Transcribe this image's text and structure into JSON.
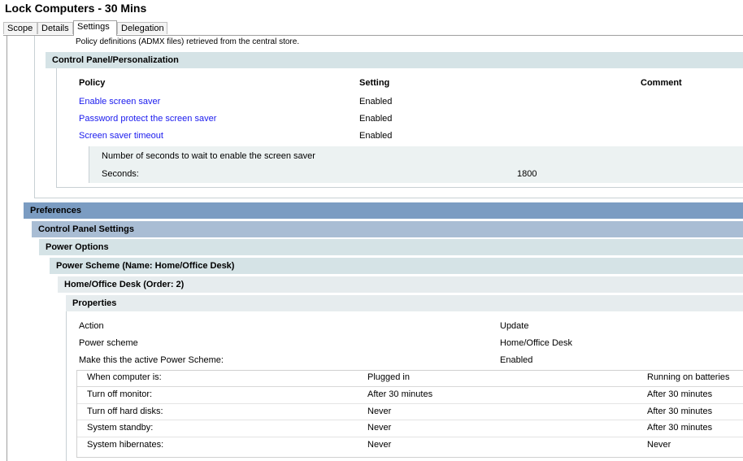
{
  "window": {
    "title": "Lock Computers - 30 Mins"
  },
  "tabs": [
    "Scope",
    "Details",
    "Settings",
    "Delegation"
  ],
  "policies": {
    "note": "Policy definitions (ADMX files) retrieved from the central store.",
    "section_title": "Control Panel/Personalization",
    "columns": {
      "policy": "Policy",
      "setting": "Setting",
      "comment": "Comment"
    },
    "rows": [
      {
        "policy": "Enable screen saver",
        "setting": "Enabled"
      },
      {
        "policy": "Password protect the screen saver",
        "setting": "Enabled"
      },
      {
        "policy": "Screen saver timeout",
        "setting": "Enabled"
      }
    ],
    "timeout_detail": {
      "description": "Number of seconds to wait to enable the screen saver",
      "label": "Seconds:",
      "value": "1800"
    }
  },
  "preferences": {
    "title": "Preferences",
    "control_panel": "Control Panel Settings",
    "power_options": "Power Options",
    "power_scheme": "Power Scheme (Name: Home/Office Desk)",
    "scheme_item": "Home/Office Desk (Order: 2)",
    "properties": "Properties",
    "props": [
      {
        "label": "Action",
        "value": "Update"
      },
      {
        "label": "Power scheme",
        "value": "Home/Office Desk"
      },
      {
        "label": "Make this the active Power Scheme:",
        "value": "Enabled"
      }
    ],
    "table": {
      "header": [
        "When computer is:",
        "Plugged in",
        "Running on batteries"
      ],
      "rows": [
        [
          "Turn off monitor:",
          "After 30 minutes",
          "After 30 minutes"
        ],
        [
          "Turn off hard disks:",
          "Never",
          "After 30 minutes"
        ],
        [
          "System standby:",
          "Never",
          "After 30 minutes"
        ],
        [
          "System hibernates:",
          "Never",
          "Never"
        ]
      ]
    }
  },
  "colors": {
    "preferences_bg": "#7b9cc2",
    "control_panel_bg": "#a9bdd4",
    "section_bg": "#d5e3e6",
    "properties_bg": "#e6ecee",
    "detail_bg": "#ecf2f2",
    "link": "#1a1aee"
  }
}
